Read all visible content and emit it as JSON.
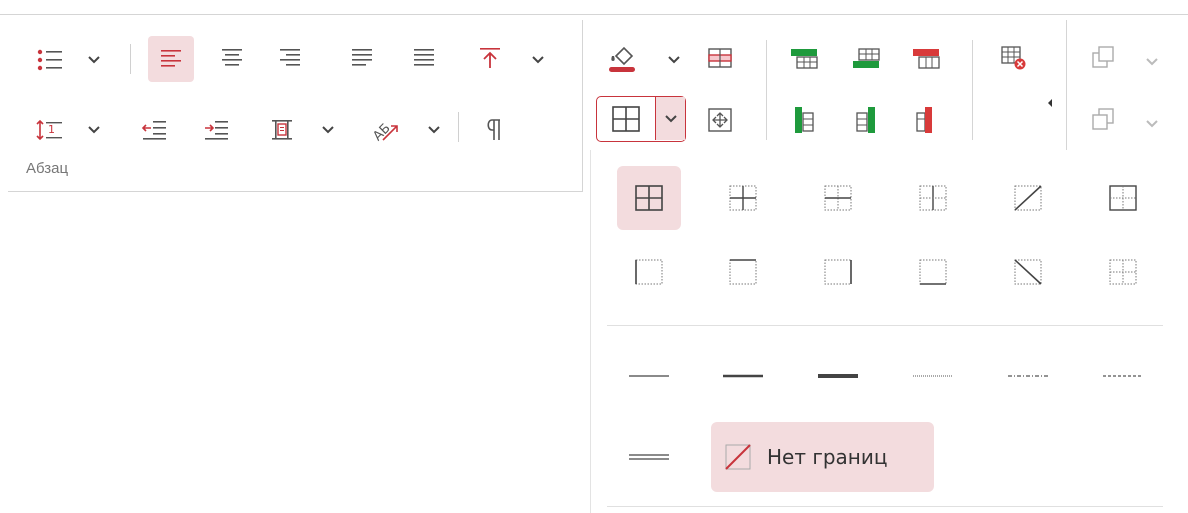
{
  "paragraph_group": {
    "label": "Абзац",
    "buttons": {
      "bullets": "bullet-list-icon",
      "align_left": "align-left-icon",
      "align_center": "align-center-icon",
      "align_right": "align-right-icon",
      "justify": "justify-icon",
      "distributed": "distributed-icon",
      "vertical_align": "vertical-align-top-icon",
      "line_spacing": "line-spacing-icon",
      "decrease_indent": "decrease-indent-icon",
      "increase_indent": "increase-indent-icon",
      "cell_margins": "cell-margins-icon",
      "text_direction": "text-direction-icon",
      "formatting_marks": "pilcrow-icon"
    },
    "active_button": "align_left",
    "text_direction_sample": "АБ"
  },
  "table_group": {
    "active_button": "borders",
    "buttons": [
      "fill-color-icon",
      "cell-borders-icon",
      "select-table-icon",
      "insert-row-above-icon",
      "insert-row-below-icon",
      "delete-row-icon",
      "insert-column-left-icon",
      "insert-column-right-icon",
      "delete-column-icon",
      "delete-table-icon",
      "bring-forward-icon",
      "send-backward-icon"
    ]
  },
  "borders_popup": {
    "no_borders_label": "Нет границ",
    "active_preset": "all-borders",
    "colors": {
      "accent": "#c8343c",
      "active_bg": "#f3dcde",
      "green": "#1e9a3c",
      "red": "#d83a3a"
    }
  }
}
